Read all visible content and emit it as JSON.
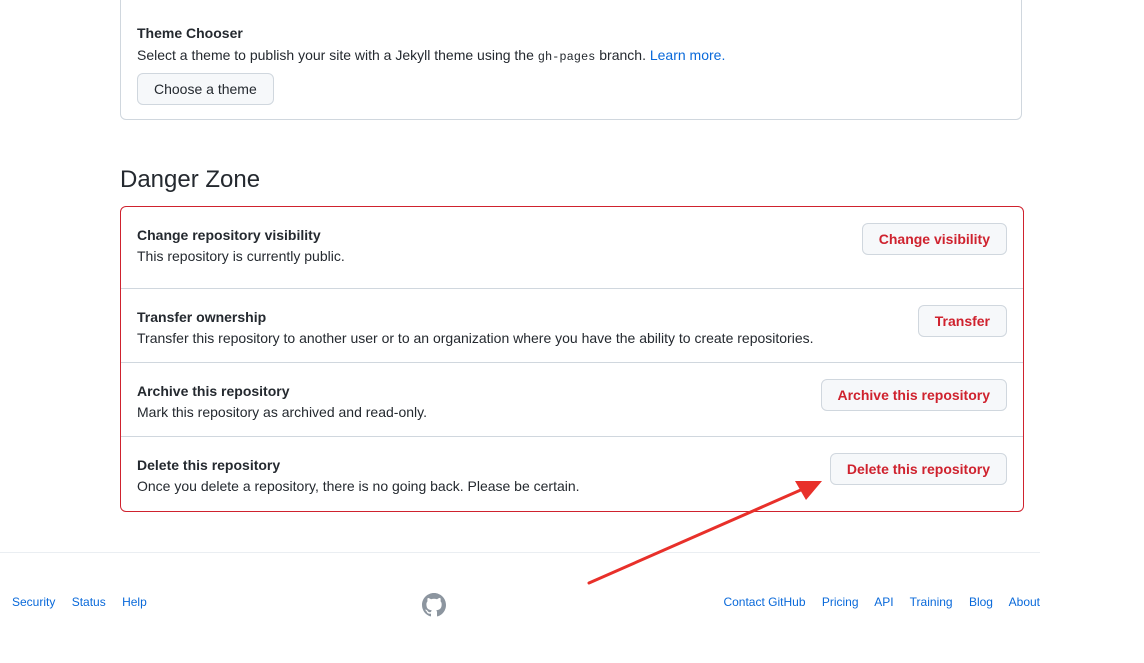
{
  "pages": {
    "theme_title": "Theme Chooser",
    "theme_desc_before": "Select a theme to publish your site with a Jekyll theme using the ",
    "theme_desc_code": "gh-pages",
    "theme_desc_after": " branch. ",
    "learn_more": "Learn more.",
    "choose_theme_button": "Choose a theme"
  },
  "danger_zone": {
    "heading": "Danger Zone",
    "rows": [
      {
        "title": "Change repository visibility",
        "desc": "This repository is currently public.",
        "button": "Change visibility"
      },
      {
        "title": "Transfer ownership",
        "desc": "Transfer this repository to another user or to an organization where you have the ability to create repositories.",
        "button": "Transfer"
      },
      {
        "title": "Archive this repository",
        "desc": "Mark this repository as archived and read-only.",
        "button": "Archive this repository"
      },
      {
        "title": "Delete this repository",
        "desc": "Once you delete a repository, there is no going back. Please be certain.",
        "button": "Delete this repository"
      }
    ]
  },
  "footer": {
    "left_links": [
      "Security",
      "Status",
      "Help"
    ],
    "right_links": [
      "Contact GitHub",
      "Pricing",
      "API",
      "Training",
      "Blog",
      "About"
    ],
    "logo_icon": "github-mark-icon"
  },
  "annotation": {
    "arrow_color": "#e8302a"
  },
  "colors": {
    "danger": "#cf222e",
    "link": "#0969da",
    "border": "#d0d7de"
  }
}
